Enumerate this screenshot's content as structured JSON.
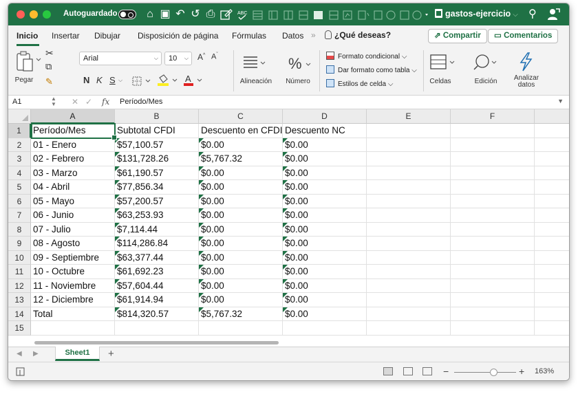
{
  "titlebar": {
    "autosave_label": "Autoguardado",
    "document_name": "gastos-ejercicio",
    "doc_chevron": "⌵"
  },
  "tabs": [
    {
      "label": "Inicio",
      "active": true
    },
    {
      "label": "Insertar"
    },
    {
      "label": "Dibujar"
    },
    {
      "label": "Disposición de página"
    },
    {
      "label": "Fórmulas"
    },
    {
      "label": "Datos"
    }
  ],
  "tell_me": "¿Qué deseas?",
  "share_button": "Compartir",
  "comments_button": "Comentarios",
  "ribbon": {
    "paste_label": "Pegar",
    "font_name": "Arial",
    "font_size": "10",
    "bold": "N",
    "italic": "K",
    "underline": "S",
    "alignment_label": "Alineación",
    "number_label": "Número",
    "conditional_format": "Formato condicional",
    "format_as_table": "Dar formato como tabla",
    "cell_styles": "Estilos de celda",
    "cells_label": "Celdas",
    "editing_label": "Edición",
    "analyze_label_1": "Analizar",
    "analyze_label_2": "datos"
  },
  "formula_bar": {
    "name_box": "A1",
    "fx": "fx",
    "content": "Período/Mes"
  },
  "columns": [
    "A",
    "B",
    "C",
    "D",
    "E",
    "F"
  ],
  "rows": [
    "1",
    "2",
    "3",
    "4",
    "5",
    "6",
    "7",
    "8",
    "9",
    "10",
    "11",
    "12",
    "13",
    "14",
    "15"
  ],
  "table": [
    [
      "Período/Mes",
      "Subtotal CFDI",
      "Descuento en CFDI",
      "Descuento NC"
    ],
    [
      "01 - Enero",
      "$57,100.57",
      "$0.00",
      "$0.00"
    ],
    [
      "02 - Febrero",
      "$131,728.26",
      "$5,767.32",
      "$0.00"
    ],
    [
      "03 - Marzo",
      "$61,190.57",
      "$0.00",
      "$0.00"
    ],
    [
      "04 - Abril",
      "$77,856.34",
      "$0.00",
      "$0.00"
    ],
    [
      "05 - Mayo",
      "$57,200.57",
      "$0.00",
      "$0.00"
    ],
    [
      "06 - Junio",
      "$63,253.93",
      "$0.00",
      "$0.00"
    ],
    [
      "07 - Julio",
      "$7,114.44",
      "$0.00",
      "$0.00"
    ],
    [
      "08 - Agosto",
      "$114,286.84",
      "$0.00",
      "$0.00"
    ],
    [
      "09 - Septiembre",
      "$63,377.44",
      "$0.00",
      "$0.00"
    ],
    [
      "10 - Octubre",
      "$61,692.23",
      "$0.00",
      "$0.00"
    ],
    [
      "11 - Noviembre",
      "$57,604.44",
      "$0.00",
      "$0.00"
    ],
    [
      "12 - Diciembre",
      "$61,914.94",
      "$0.00",
      "$0.00"
    ],
    [
      "Total",
      "$814,320.57",
      "$5,767.32",
      "$0.00"
    ]
  ],
  "sheet_tab": "Sheet1",
  "add_sheet": "+",
  "zoom_level": "163%",
  "zoom_minus": "−",
  "zoom_plus": "+",
  "colors": {
    "accent": "#1f7145",
    "number_indicator": "#1f7145"
  },
  "icons": {
    "home": "⌂",
    "save": "▣",
    "undo": "↶",
    "redo": "↺",
    "print": "⎙",
    "search": "⚲"
  }
}
